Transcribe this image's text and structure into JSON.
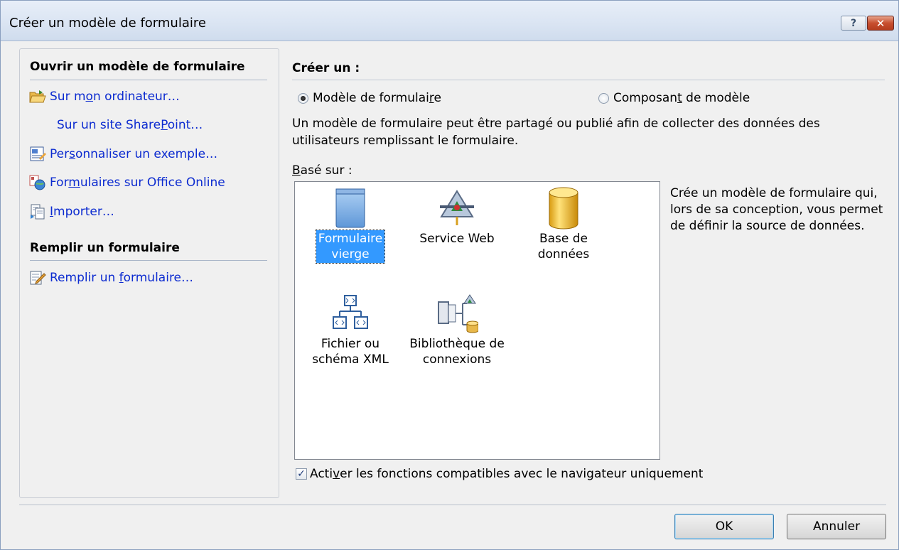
{
  "window": {
    "title": "Créer un modèle de formulaire",
    "help_button": "?",
    "close_button": "✕"
  },
  "left": {
    "open_heading": "Ouvrir un modèle de formulaire",
    "open_items": [
      {
        "pre": "Sur m",
        "ul": "o",
        "post": "n ordinateur…",
        "icon": "open-folder-icon"
      },
      {
        "pre": "Sur un site Share",
        "ul": "P",
        "post": "oint…",
        "icon": "none"
      },
      {
        "pre": "Per",
        "ul": "s",
        "post": "onnaliser un exemple…",
        "icon": "sample-form-icon"
      },
      {
        "pre": "For",
        "ul": "m",
        "post": "ulaires sur Office Online",
        "icon": "office-online-icon"
      },
      {
        "pre": "",
        "ul": "I",
        "post": "mporter…",
        "icon": "import-icon"
      }
    ],
    "fill_heading": "Remplir un formulaire",
    "fill_items": [
      {
        "pre": "Remplir un ",
        "ul": "f",
        "post": "ormulaire…",
        "icon": "fill-form-icon"
      }
    ]
  },
  "right": {
    "create_heading": "Créer un :",
    "radio_template": {
      "pre": "Modèle de formulai",
      "ul": "r",
      "post": "e",
      "checked": true
    },
    "radio_component": {
      "pre": "Composan",
      "ul": "t",
      "post": " de modèle",
      "checked": false
    },
    "description": "Un modèle de formulaire peut être partagé ou publié afin de collecter des données des utilisateurs remplissant le formulaire.",
    "based_on_label": {
      "pre": "",
      "ul": "B",
      "post": "asé sur :"
    },
    "tiles": [
      {
        "line1": "Formulaire",
        "line2": "vierge",
        "icon": "blank-form-icon",
        "selected": true
      },
      {
        "line1": "Service Web",
        "line2": "",
        "icon": "web-service-icon",
        "selected": false
      },
      {
        "line1": "Base de",
        "line2": "données",
        "icon": "database-icon",
        "selected": false
      },
      {
        "line1": "Fichier ou",
        "line2": "schéma XML",
        "icon": "xml-schema-icon",
        "selected": false
      },
      {
        "line1": "Bibliothèque de",
        "line2": "connexions",
        "icon": "connection-library-icon",
        "selected": false
      }
    ],
    "selected_description": "Crée un modèle de formulaire qui, lors de sa conception, vous permet de définir la source de données.",
    "browser_checkbox": {
      "pre": "Acti",
      "ul": "v",
      "post": "er les fonctions compatibles avec le navigateur uniquement",
      "checked": true
    }
  },
  "buttons": {
    "ok": "OK",
    "cancel": "Annuler"
  }
}
